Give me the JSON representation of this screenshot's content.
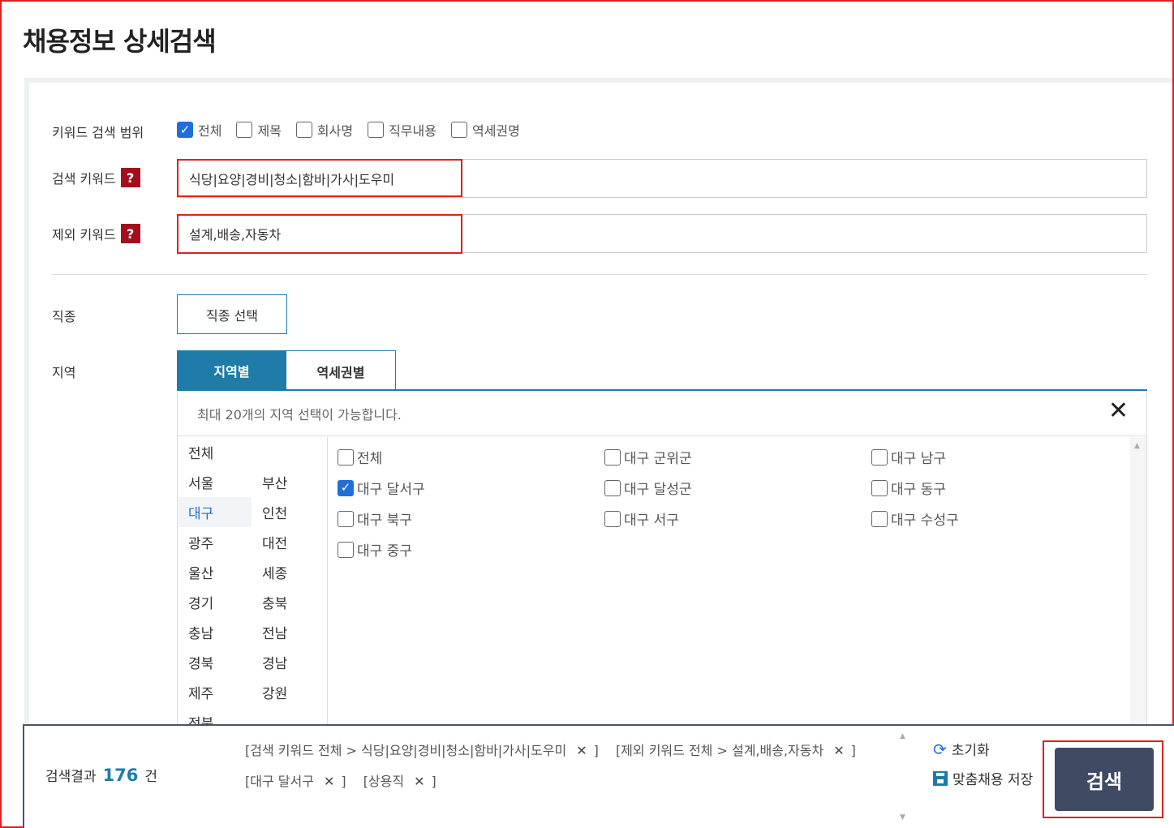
{
  "page_title": "채용정보 상세검색",
  "keyword_scope": {
    "label": "키워드 검색 범위",
    "options": [
      {
        "label": "전체",
        "checked": true
      },
      {
        "label": "제목",
        "checked": false
      },
      {
        "label": "회사명",
        "checked": false
      },
      {
        "label": "직무내용",
        "checked": false
      },
      {
        "label": "역세권명",
        "checked": false
      }
    ]
  },
  "search_keyword": {
    "label": "검색 키워드",
    "help": "?",
    "value": "식당|요양|경비|청소|함바|가사|도우미"
  },
  "exclude_keyword": {
    "label": "제외 키워드",
    "help": "?",
    "value": "설계,배송,자동차"
  },
  "job_type": {
    "label": "직종",
    "button": "직종 선택"
  },
  "region": {
    "label": "지역",
    "tabs": [
      "지역별",
      "역세권별"
    ],
    "notice": "최대 20개의 지역 선택이 가능합니다.",
    "close": "✕",
    "cities": [
      "전체",
      "서울",
      "부산",
      "대구",
      "인천",
      "광주",
      "대전",
      "울산",
      "세종",
      "경기",
      "충북",
      "충남",
      "전남",
      "경북",
      "경남",
      "제주",
      "강원",
      "전북"
    ],
    "active_city": "대구",
    "districts": [
      {
        "label": "전체",
        "checked": false
      },
      {
        "label": "대구 군위군",
        "checked": false
      },
      {
        "label": "대구 남구",
        "checked": false
      },
      {
        "label": "대구 달서구",
        "checked": true
      },
      {
        "label": "대구 달성군",
        "checked": false
      },
      {
        "label": "대구 동구",
        "checked": false
      },
      {
        "label": "대구 북구",
        "checked": false
      },
      {
        "label": "대구 서구",
        "checked": false
      },
      {
        "label": "대구 수성구",
        "checked": false
      },
      {
        "label": "대구 중구",
        "checked": false
      }
    ]
  },
  "result": {
    "label": "검색결과",
    "count": "176",
    "unit": "건",
    "tags": [
      {
        "text": "[검색 키워드 전체 > 식당|요양|경비|청소|함바|가사|도우미",
        "close": "✕",
        "end": "]"
      },
      {
        "text": "[제외 키워드 전체 > 설계,배송,자동차",
        "close": "✕",
        "end": "]"
      },
      {
        "text": "[대구 달서구",
        "close": "✕",
        "end": "]"
      },
      {
        "text": "[상용직",
        "close": "✕",
        "end": "]"
      }
    ]
  },
  "actions": {
    "reset": "초기화",
    "save": "맞춤채용 저장",
    "search": "검색"
  },
  "colors": {
    "accent": "#1f7ba8",
    "highlight": "#e02020",
    "check": "#1e6fd9",
    "search_button": "#3f4a63",
    "help_badge": "#a50d1d"
  }
}
